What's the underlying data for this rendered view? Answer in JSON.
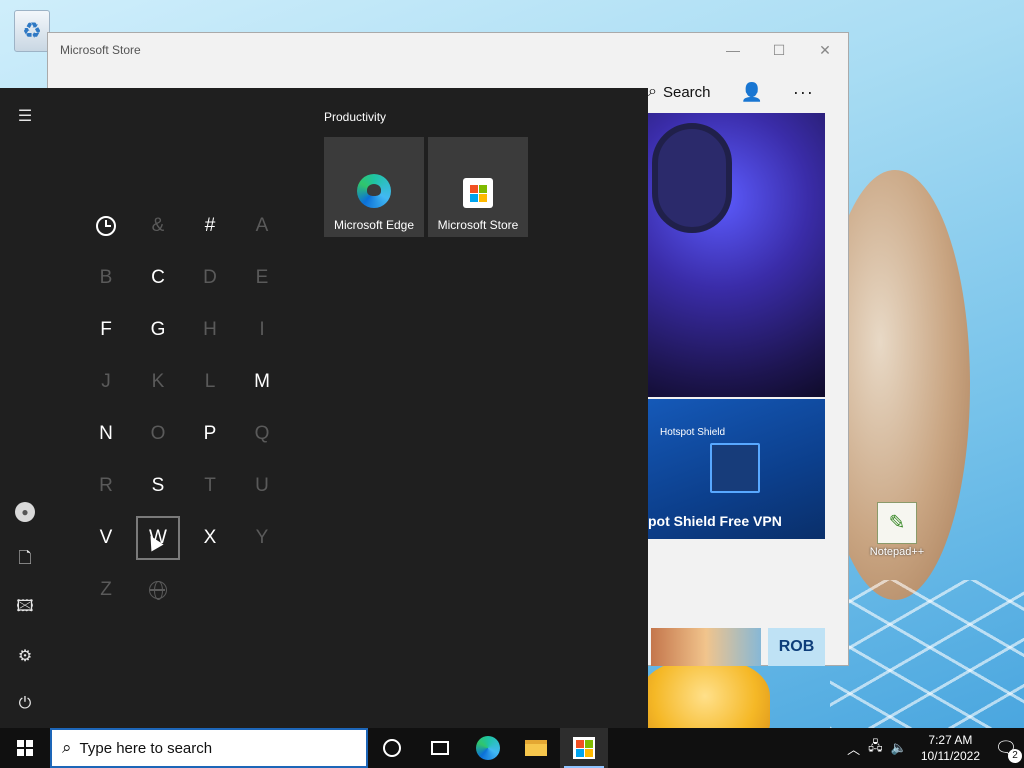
{
  "desktop": {
    "icons": [
      {
        "name": "recycle-bin",
        "label": ""
      },
      {
        "name": "notepad-plus-plus",
        "label": "Notepad++"
      }
    ]
  },
  "store_window": {
    "title": "Microsoft Store",
    "nav": {
      "search_label": "Search"
    },
    "featured": {
      "brand": "Hotspot Shield",
      "title": "pot Shield Free VPN",
      "tile_text": "ROB"
    }
  },
  "start_menu": {
    "letters": [
      {
        "char": "clock",
        "enabled": true
      },
      {
        "char": "&",
        "enabled": false
      },
      {
        "char": "#",
        "enabled": true
      },
      {
        "char": "A",
        "enabled": false
      },
      {
        "char": "B",
        "enabled": false
      },
      {
        "char": "C",
        "enabled": true
      },
      {
        "char": "D",
        "enabled": false
      },
      {
        "char": "E",
        "enabled": false
      },
      {
        "char": "F",
        "enabled": true
      },
      {
        "char": "G",
        "enabled": true
      },
      {
        "char": "H",
        "enabled": false
      },
      {
        "char": "I",
        "enabled": false
      },
      {
        "char": "J",
        "enabled": false
      },
      {
        "char": "K",
        "enabled": false
      },
      {
        "char": "L",
        "enabled": false
      },
      {
        "char": "M",
        "enabled": true
      },
      {
        "char": "N",
        "enabled": true
      },
      {
        "char": "O",
        "enabled": false
      },
      {
        "char": "P",
        "enabled": true
      },
      {
        "char": "Q",
        "enabled": false
      },
      {
        "char": "R",
        "enabled": false
      },
      {
        "char": "S",
        "enabled": true
      },
      {
        "char": "T",
        "enabled": false
      },
      {
        "char": "U",
        "enabled": false
      },
      {
        "char": "V",
        "enabled": true
      },
      {
        "char": "W",
        "enabled": true,
        "selected": true
      },
      {
        "char": "X",
        "enabled": true
      },
      {
        "char": "Y",
        "enabled": false
      },
      {
        "char": "Z",
        "enabled": false
      },
      {
        "char": "globe",
        "enabled": false
      }
    ],
    "tile_group": {
      "title": "Productivity",
      "tiles": [
        {
          "label": "Microsoft Edge",
          "icon": "edge-icon"
        },
        {
          "label": "Microsoft Store",
          "icon": "store-icon"
        }
      ]
    },
    "rail_icons": [
      "hamburger-icon",
      "user-icon",
      "document-icon",
      "pictures-icon",
      "settings-icon",
      "power-icon"
    ]
  },
  "taskbar": {
    "search_placeholder": "Type here to search",
    "time": "7:27 AM",
    "date": "10/11/2022",
    "notification_count": "2",
    "pinned": [
      "cortana-icon",
      "task-view-icon",
      "edge-icon",
      "file-explorer-icon",
      "store-icon"
    ]
  }
}
